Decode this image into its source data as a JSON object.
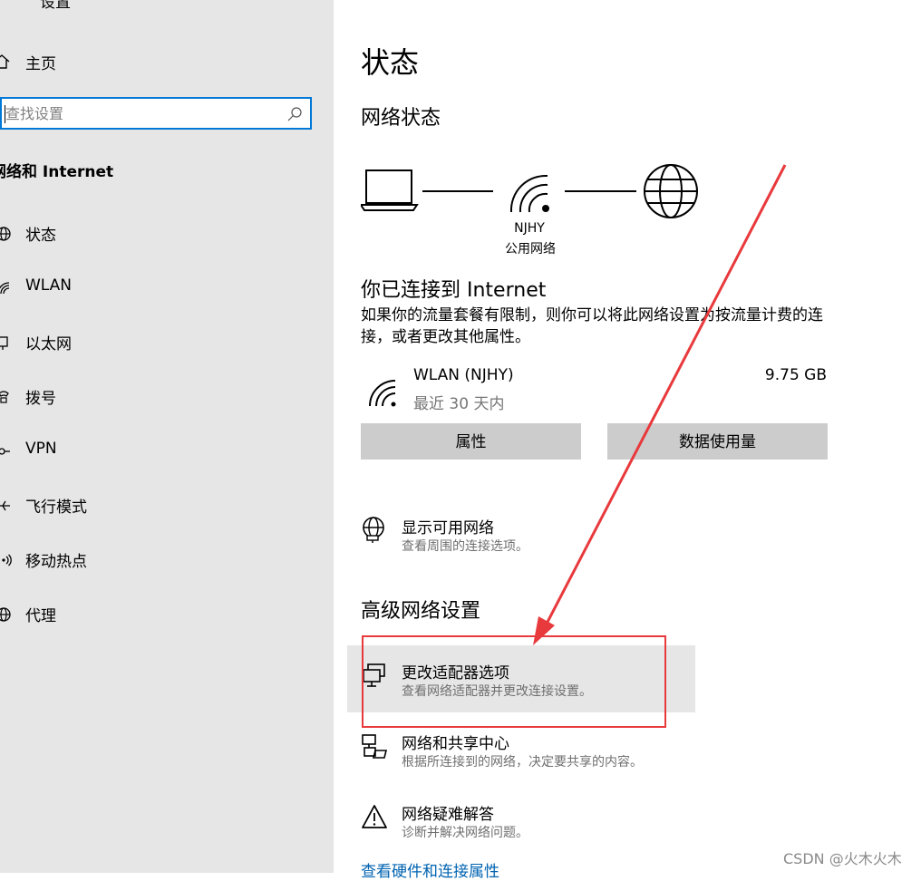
{
  "sidebar": {
    "top_cut_title": "设置",
    "home_label": "主页",
    "search_placeholder": "查找设置",
    "section_title": "网络和 Internet",
    "items": [
      {
        "label": "状态",
        "icon": "home-icon"
      },
      {
        "label": "WLAN",
        "icon": "wifi-icon"
      },
      {
        "label": "以太网",
        "icon": "ethernet-icon"
      },
      {
        "label": "拨号",
        "icon": "dialup-icon"
      },
      {
        "label": "VPN",
        "icon": "vpn-icon"
      },
      {
        "label": "飞行模式",
        "icon": "airplane-icon"
      },
      {
        "label": "移动热点",
        "icon": "hotspot-icon"
      },
      {
        "label": "代理",
        "icon": "globe-icon"
      }
    ]
  },
  "main": {
    "page_title": "状态",
    "network_status_title": "网络状态",
    "network": {
      "ssid": "NJHY",
      "type": "公用网络"
    },
    "connected_title": "你已连接到 Internet",
    "connected_desc": "如果你的流量套餐有限制，则你可以将此网络设置为按流量计费的连接，或者更改其他属性。",
    "wlan": {
      "name": "WLAN (NJHY)",
      "period": "最近 30 天内",
      "usage": "9.75 GB"
    },
    "buttons": {
      "properties": "属性",
      "data_usage": "数据使用量"
    },
    "show_networks": {
      "title": "显示可用网络",
      "desc": "查看周围的连接选项。"
    },
    "advanced_title": "高级网络设置",
    "advanced_items": [
      {
        "title": "更改适配器选项",
        "desc": "查看网络适配器并更改连接设置。",
        "icon": "network-adapter-icon"
      },
      {
        "title": "网络和共享中心",
        "desc": "根据所连接到的网络，决定要共享的内容。",
        "icon": "sharing-center-icon"
      },
      {
        "title": "网络疑难解答",
        "desc": "诊断并解决网络问题。",
        "icon": "warning-icon"
      }
    ],
    "hardware_link": "查看硬件和连接属性"
  },
  "watermark": "CSDN @火木火木",
  "colors": {
    "sidebar_bg": "#e6e6e6",
    "accent": "#0078d7",
    "button_bg": "#cccccc",
    "annotation": "#e8393c",
    "link": "#0063b1"
  }
}
